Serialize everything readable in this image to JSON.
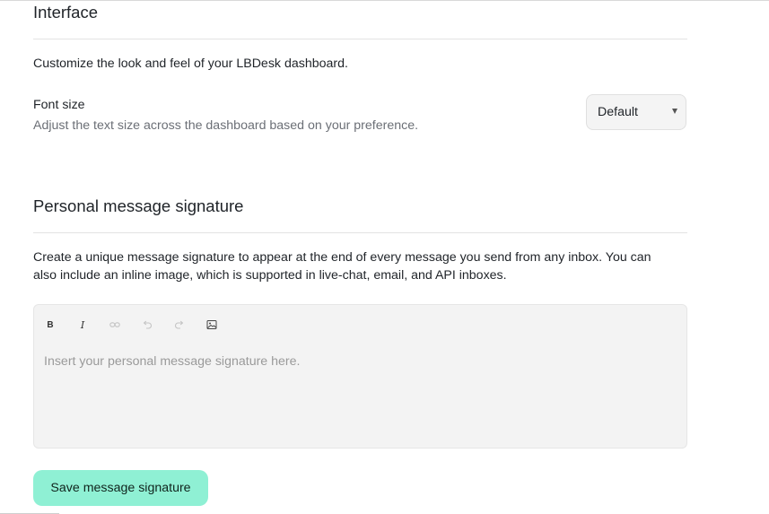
{
  "interface": {
    "title": "Interface",
    "description": "Customize the look and feel of your LBDesk dashboard.",
    "font_size": {
      "label": "Font size",
      "help": "Adjust the text size across the dashboard based on your preference.",
      "selected": "Default"
    }
  },
  "signature": {
    "title": "Personal message signature",
    "description_line1": "Create a unique message signature to appear at the end of every message you send from any inbox. You can",
    "description_line2": "also include an inline image, which is supported in live-chat, email, and API inboxes.",
    "toolbar": {
      "bold": "B",
      "italic": "I",
      "link_icon": "link-icon",
      "undo_icon": "undo-icon",
      "redo_icon": "redo-icon",
      "image_icon": "image-upload-icon"
    },
    "placeholder": "Insert your personal message signature here.",
    "save_label": "Save message signature"
  },
  "colors": {
    "accent": "#8ff0d4",
    "editor_bg": "#f3f3f3"
  }
}
